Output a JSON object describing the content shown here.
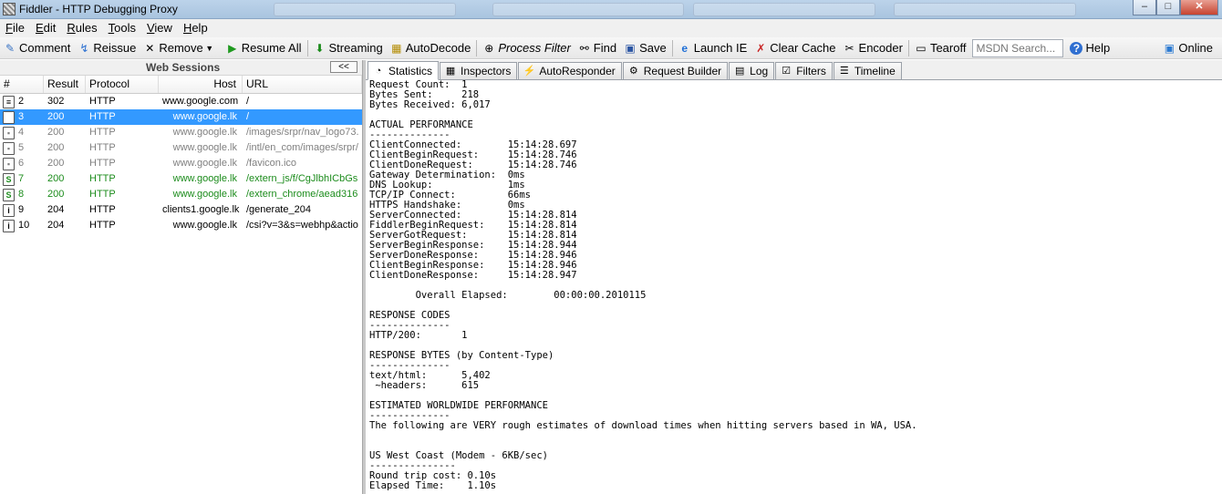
{
  "window": {
    "title": "Fiddler - HTTP Debugging Proxy"
  },
  "menu": [
    {
      "ul": "F",
      "rest": "ile"
    },
    {
      "ul": "E",
      "rest": "dit"
    },
    {
      "ul": "R",
      "rest": "ules"
    },
    {
      "ul": "T",
      "rest": "ools"
    },
    {
      "ul": "V",
      "rest": "iew"
    },
    {
      "ul": "H",
      "rest": "elp"
    }
  ],
  "toolbar": {
    "comment": "Comment",
    "reissue": "Reissue",
    "remove": "Remove",
    "resume_all": "Resume All",
    "streaming": "Streaming",
    "autodecode": "AutoDecode",
    "process_filter": "Process Filter",
    "find": "Find",
    "save": "Save",
    "launch_ie": "Launch IE",
    "clear_cache": "Clear Cache",
    "encoder": "Encoder",
    "tearoff": "Tearoff",
    "search_placeholder": "MSDN Search...",
    "help": "Help",
    "online": "Online"
  },
  "sessions": {
    "title": "Web Sessions",
    "collapse": "<<",
    "columns": {
      "num": "#",
      "result": "Result",
      "protocol": "Protocol",
      "host": "Host",
      "url": "URL"
    },
    "rows": [
      {
        "num": "2",
        "result": "302",
        "protocol": "HTTP",
        "host": "www.google.com",
        "url": "/",
        "style": "normal",
        "icon": "≡"
      },
      {
        "num": "3",
        "result": "200",
        "protocol": "HTTP",
        "host": "www.google.lk",
        "url": "/",
        "style": "selected",
        "icon": "◈"
      },
      {
        "num": "4",
        "result": "200",
        "protocol": "HTTP",
        "host": "www.google.lk",
        "url": "/images/srpr/nav_logo73.",
        "style": "gray",
        "icon": "▪"
      },
      {
        "num": "5",
        "result": "200",
        "protocol": "HTTP",
        "host": "www.google.lk",
        "url": "/intl/en_com/images/srpr/",
        "style": "gray",
        "icon": "▪"
      },
      {
        "num": "6",
        "result": "200",
        "protocol": "HTTP",
        "host": "www.google.lk",
        "url": "/favicon.ico",
        "style": "gray",
        "icon": "▪"
      },
      {
        "num": "7",
        "result": "200",
        "protocol": "HTTP",
        "host": "www.google.lk",
        "url": "/extern_js/f/CgJlbhICbGs",
        "style": "green",
        "icon": "S"
      },
      {
        "num": "8",
        "result": "200",
        "protocol": "HTTP",
        "host": "www.google.lk",
        "url": "/extern_chrome/aead316",
        "style": "green",
        "icon": "S"
      },
      {
        "num": "9",
        "result": "204",
        "protocol": "HTTP",
        "host": "clients1.google.lk",
        "url": "/generate_204",
        "style": "normal",
        "icon": "i"
      },
      {
        "num": "10",
        "result": "204",
        "protocol": "HTTP",
        "host": "www.google.lk",
        "url": "/csi?v=3&s=webhp&actio",
        "style": "normal",
        "icon": "i"
      }
    ]
  },
  "tabs": [
    {
      "label": "Statistics",
      "icon": "◔",
      "active": true
    },
    {
      "label": "Inspectors",
      "icon": "▦",
      "active": false
    },
    {
      "label": "AutoResponder",
      "icon": "⚡",
      "active": false
    },
    {
      "label": "Request Builder",
      "icon": "⚙",
      "active": false
    },
    {
      "label": "Log",
      "icon": "▤",
      "active": false
    },
    {
      "label": "Filters",
      "icon": "☑",
      "active": false
    },
    {
      "label": "Timeline",
      "icon": "☰",
      "active": false
    }
  ],
  "statistics": [
    "Request Count:  1",
    "Bytes Sent:     218",
    "Bytes Received: 6,017",
    "",
    "ACTUAL PERFORMANCE",
    "--------------",
    "ClientConnected:        15:14:28.697",
    "ClientBeginRequest:     15:14:28.746",
    "ClientDoneRequest:      15:14:28.746",
    "Gateway Determination:  0ms",
    "DNS Lookup:             1ms",
    "TCP/IP Connect:         66ms",
    "HTTPS Handshake:        0ms",
    "ServerConnected:        15:14:28.814",
    "FiddlerBeginRequest:    15:14:28.814",
    "ServerGotRequest:       15:14:28.814",
    "ServerBeginResponse:    15:14:28.944",
    "ServerDoneResponse:     15:14:28.946",
    "ClientBeginResponse:    15:14:28.946",
    "ClientDoneResponse:     15:14:28.947",
    "",
    "        Overall Elapsed:        00:00:00.2010115",
    "",
    "RESPONSE CODES",
    "--------------",
    "HTTP/200:       1",
    "",
    "RESPONSE BYTES (by Content-Type)",
    "--------------",
    "text/html:      5,402",
    " ~headers:      615",
    "",
    "ESTIMATED WORLDWIDE PERFORMANCE",
    "--------------",
    "The following are VERY rough estimates of download times when hitting servers based in WA, USA.",
    "",
    "",
    "US West Coast (Modem - 6KB/sec)",
    "---------------",
    "Round trip cost: 0.10s",
    "Elapsed Time:    1.10s"
  ]
}
